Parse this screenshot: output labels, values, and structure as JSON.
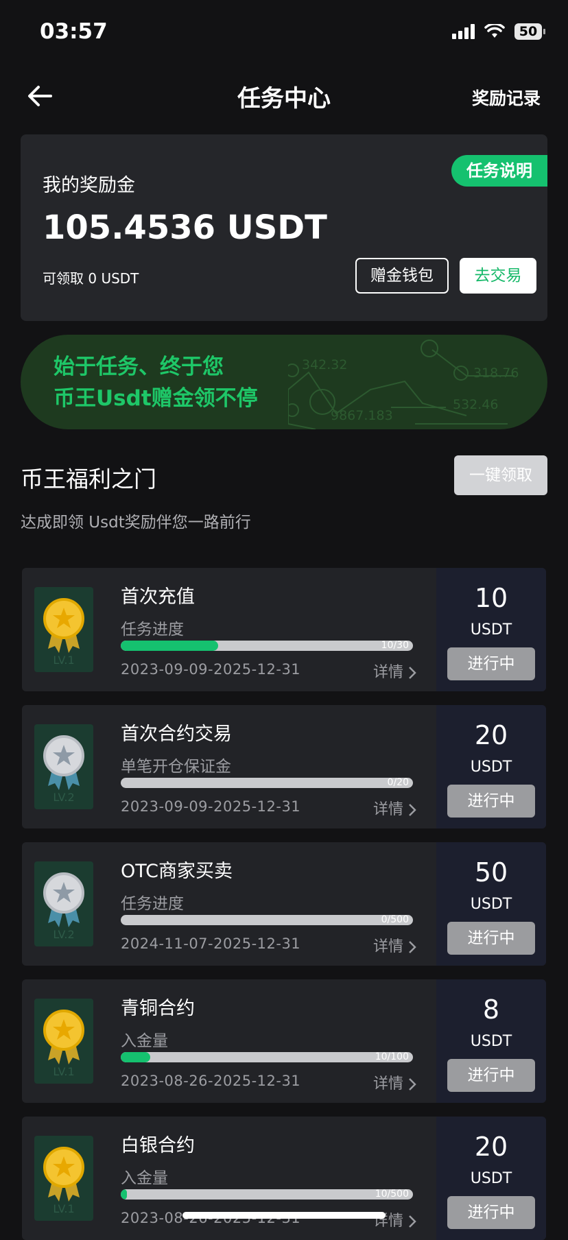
{
  "status_bar": {
    "time": "03:57",
    "battery": "50"
  },
  "nav": {
    "title": "任务中心",
    "right_action": "奖励记录"
  },
  "wallet": {
    "label": "我的奖励金",
    "amount": "105.4536 USDT",
    "claimable": "可领取 0 USDT",
    "tag": "任务说明",
    "btn_bonus_wallet": "赠金钱包",
    "btn_trade": "去交易"
  },
  "banner": {
    "line1": "始于任务、终于您",
    "line2": "币王Usdt赠金领不停",
    "numbers": [
      "342.32",
      "318.76",
      "9867.183",
      "532.46"
    ]
  },
  "section": {
    "title": "币王福利之门",
    "subtitle": "达成即领 Usdt奖励伴您一路前行",
    "claim_all": "一键领取"
  },
  "tasks": [
    {
      "title": "首次充值",
      "subtitle": "任务进度",
      "progress_label": "10/30",
      "progress_fraction": 0.333,
      "date": "2023-09-09-2025-12-31",
      "detail": "详情",
      "reward": "10",
      "unit": "USDT",
      "status": "进行中",
      "medal": "gold"
    },
    {
      "title": "首次合约交易",
      "subtitle": "单笔开仓保证金",
      "progress_label": "0/20",
      "progress_fraction": 0,
      "date": "2023-09-09-2025-12-31",
      "detail": "详情",
      "reward": "20",
      "unit": "USDT",
      "status": "进行中",
      "medal": "silver"
    },
    {
      "title": "OTC商家买卖",
      "subtitle": "任务进度",
      "progress_label": "0/500",
      "progress_fraction": 0,
      "date": "2024-11-07-2025-12-31",
      "detail": "详情",
      "reward": "50",
      "unit": "USDT",
      "status": "进行中",
      "medal": "silver"
    },
    {
      "title": "青铜合约",
      "subtitle": "入金量",
      "progress_label": "10/100",
      "progress_fraction": 0.1,
      "date": "2023-08-26-2025-12-31",
      "detail": "详情",
      "reward": "8",
      "unit": "USDT",
      "status": "进行中",
      "medal": "gold"
    },
    {
      "title": "白银合约",
      "subtitle": "入金量",
      "progress_label": "10/500",
      "progress_fraction": 0.02,
      "date": "2023-08-26-2025-12-31",
      "detail": "详情",
      "reward": "20",
      "unit": "USDT",
      "status": "进行中",
      "medal": "gold"
    }
  ],
  "colors": {
    "accent": "#15c16f",
    "background": "#121214",
    "card": "#25262a",
    "reward_bg": "#1c1f2e"
  }
}
